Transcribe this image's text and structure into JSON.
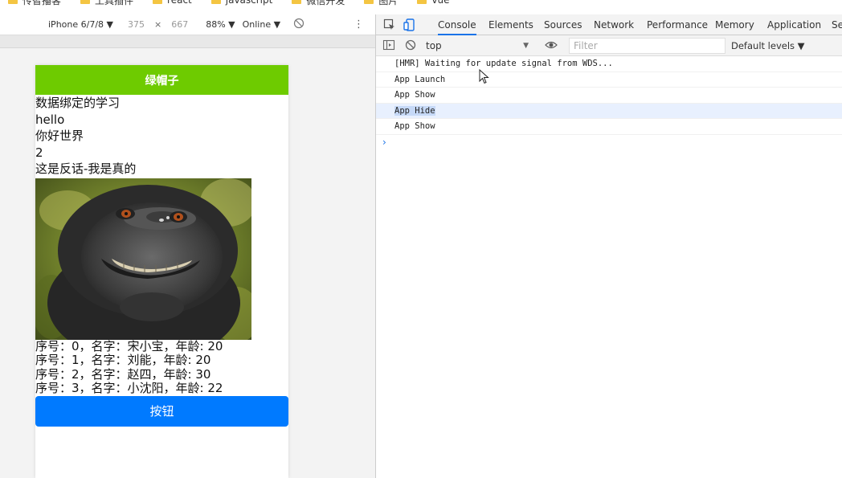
{
  "bookmarks": [
    {
      "label": "传智播客"
    },
    {
      "label": "工具插件"
    },
    {
      "label": "react"
    },
    {
      "label": "javascript"
    },
    {
      "label": "微信开发"
    },
    {
      "label": "图片"
    },
    {
      "label": "vue"
    }
  ],
  "device_toolbar": {
    "device": "iPhone 6/7/8 ▼",
    "width": "375",
    "times": "×",
    "height": "667",
    "zoom": "88% ▼",
    "network": "Online ▼"
  },
  "phone": {
    "nav_title": "绿帽子",
    "lines": [
      "数据绑定的学习",
      "hello",
      "你好世界",
      "2",
      "这是反话-我是真的"
    ],
    "list": [
      "序号：0，名字：宋小宝，年龄: 20",
      "序号：1，名字：刘能，年龄: 20",
      "序号：2，名字：赵四，年龄: 30",
      "序号：3，名字：小沈阳，年龄: 22"
    ],
    "button_label": "按钮"
  },
  "devtools": {
    "tabs": [
      "Console",
      "Elements",
      "Sources",
      "Network",
      "Performance",
      "Memory",
      "Application",
      "Se"
    ],
    "active_tab": "Console",
    "context": "top",
    "filter_placeholder": "Filter",
    "levels": "Default levels ▼",
    "console_lines": [
      "[HMR] Waiting for update signal from WDS...",
      "App Launch",
      "App Show",
      "App Hide",
      "App Show"
    ],
    "prompt": "›"
  },
  "colors": {
    "nav_green": "#6ecb00",
    "button_blue": "#007aff",
    "devtools_accent": "#1a73e8",
    "highlight_row": "#e8f0fe"
  }
}
